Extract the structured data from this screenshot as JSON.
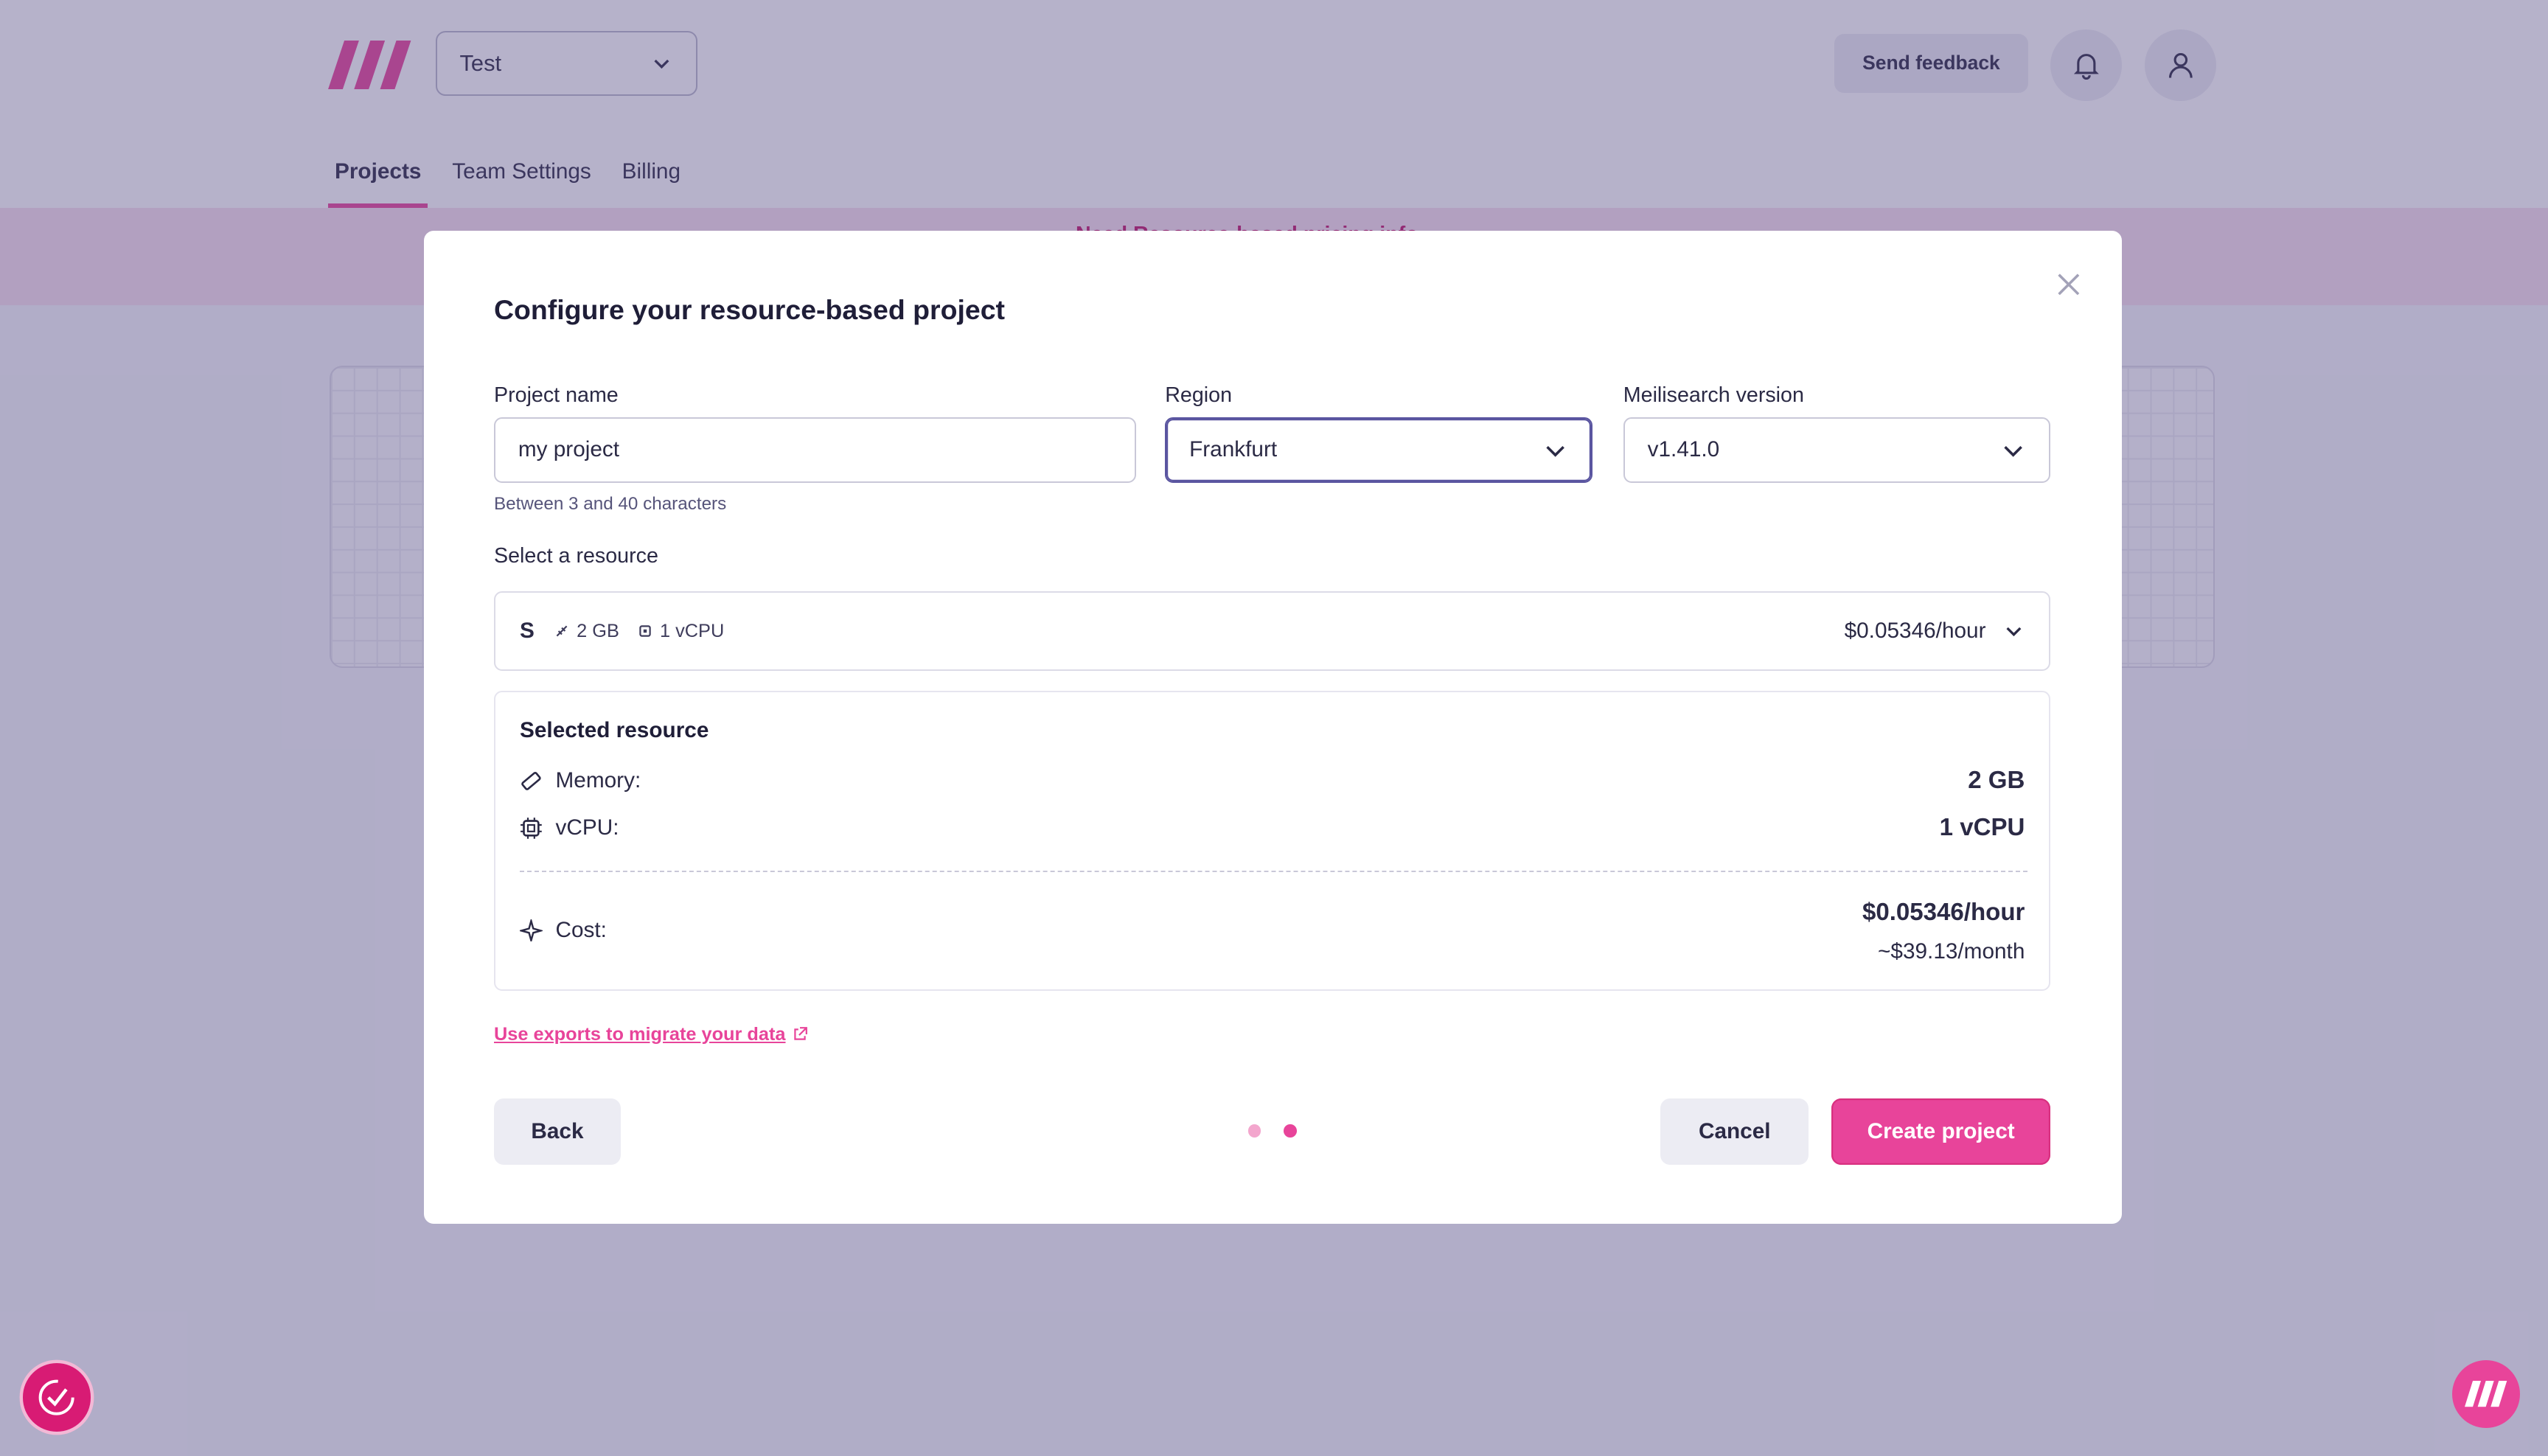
{
  "header": {
    "team_name": "Test",
    "feedback_label": "Send feedback",
    "tabs": [
      {
        "label": "Projects"
      },
      {
        "label": "Team Settings"
      },
      {
        "label": "Billing"
      }
    ]
  },
  "banner": {
    "text": "Need Resource-based pricing info..."
  },
  "modal": {
    "title": "Configure your resource-based project",
    "project_name_label": "Project name",
    "project_name_value": "my project",
    "project_name_hint": "Between 3 and 40 characters",
    "region_label": "Region",
    "region_value": "Frankfurt",
    "version_label": "Meilisearch version",
    "version_value": "v1.41.0",
    "resource_label": "Select a resource",
    "resource": {
      "size": "S",
      "memory": "2 GB",
      "vcpu": "1 vCPU",
      "price": "$0.05346/hour"
    },
    "summary": {
      "title": "Selected resource",
      "memory_label": "Memory:",
      "memory_value": "2 GB",
      "vcpu_label": "vCPU:",
      "vcpu_value": "1 vCPU",
      "cost_label": "Cost:",
      "cost_hourly": "$0.05346/hour",
      "cost_monthly": "~$39.13/month"
    },
    "export_link": "Use exports to migrate your data",
    "back_label": "Back",
    "cancel_label": "Cancel",
    "create_label": "Create project",
    "steps": {
      "total": 2,
      "current": 2
    }
  },
  "colors": {
    "accent": "#e8449a",
    "overlay": "#6a6394"
  },
  "icons": [
    "chevron-down-icon",
    "bell-icon",
    "user-icon",
    "close-icon",
    "memory-icon",
    "cpu-icon",
    "sparkle-icon",
    "external-link-icon",
    "help-check-icon",
    "meilisearch-logo-icon"
  ]
}
